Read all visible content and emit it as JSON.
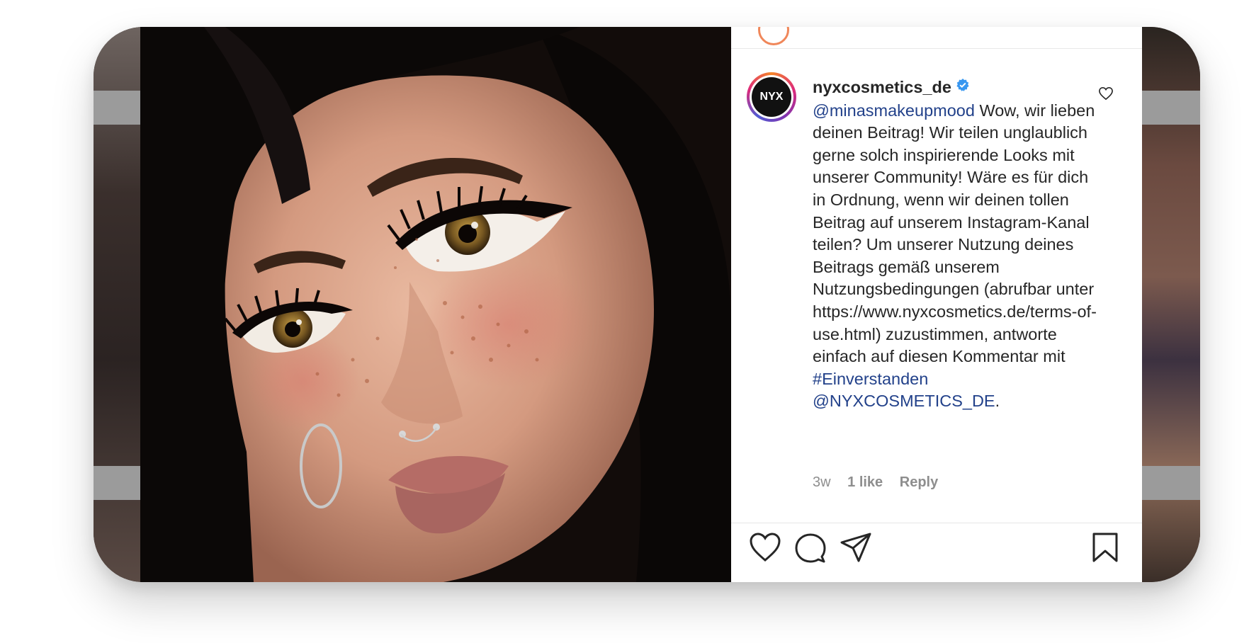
{
  "post": {
    "account": "nyxcosmetics_de",
    "avatar_text": "NYX",
    "comment_mention": "@minasmakeupmood",
    "comment_body": " Wow, wir lieben deinen Beitrag! Wir teilen unglaublich gerne solch inspirierende Looks mit unserer Community! Wäre es für dich in Ordnung, wenn wir deinen tollen Beitrag auf unserem Instagram-Kanal teilen? Um unserer Nutzung deines Beitrags gemäß unserem Nutzungsbedingungen (abrufbar unter ",
    "comment_url": "https://www.nyxcosmetics.de/terms-of-use.html",
    "comment_after_url": ") zuzustimmen, antworte einfach auf diesen Kommentar mit ",
    "comment_hashtag": "#Einverstanden",
    "comment_space": " ",
    "comment_mention2": "@NYXCOSMETICS_DE",
    "comment_end": ".",
    "meta": {
      "time": "3w",
      "likes": "1 like",
      "reply": "Reply"
    }
  },
  "colors": {
    "link": "#22418a",
    "verified": "#3897f0",
    "text": "#262626",
    "muted": "#8e8e8e"
  },
  "icons": [
    "heart-icon",
    "comment-icon",
    "share-icon",
    "bookmark-icon",
    "verified-badge-icon",
    "small-heart-icon"
  ]
}
